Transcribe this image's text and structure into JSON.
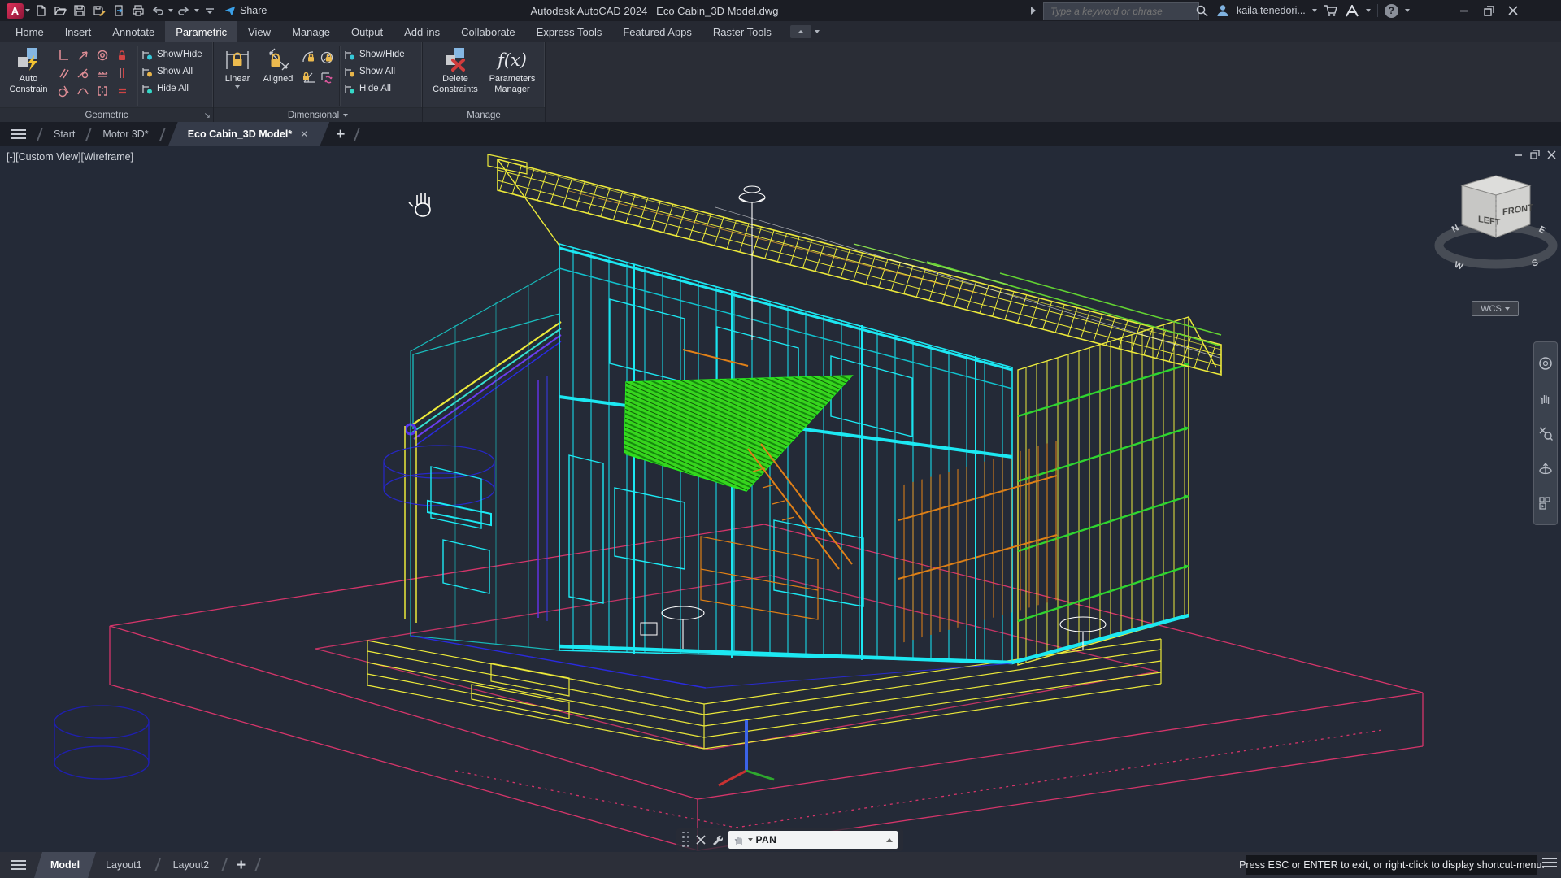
{
  "title_bar": {
    "logo_letter": "A",
    "share_label": "Share",
    "app_title": "Autodesk AutoCAD 2024",
    "file_name": "Eco Cabin_3D Model.dwg",
    "search_placeholder": "Type a keyword or phrase",
    "username": "kaila.tenedori...",
    "help_label": "?"
  },
  "ribbon": {
    "tabs": [
      "Home",
      "Insert",
      "Annotate",
      "Parametric",
      "View",
      "Manage",
      "Output",
      "Add-ins",
      "Collaborate",
      "Express Tools",
      "Featured Apps",
      "Raster Tools"
    ],
    "active_tab": "Parametric",
    "geometric": {
      "title": "Geometric",
      "auto_constrain_line1": "Auto",
      "auto_constrain_line2": "Constrain",
      "show_hide": "Show/Hide",
      "show_all": "Show All",
      "hide_all": "Hide All"
    },
    "dimensional": {
      "title": "Dimensional",
      "linear": "Linear",
      "aligned": "Aligned",
      "show_hide": "Show/Hide",
      "show_all": "Show All",
      "hide_all": "Hide All"
    },
    "manage": {
      "title": "Manage",
      "delete_line1": "Delete",
      "delete_line2": "Constraints",
      "params_line1": "Parameters",
      "params_line2": "Manager",
      "fx": "f(x)"
    }
  },
  "file_tabs": {
    "items": [
      "Start",
      "Motor 3D*",
      "Eco Cabin_3D Model*"
    ],
    "active": "Eco Cabin_3D Model*"
  },
  "viewport": {
    "controls": [
      "[-]",
      "[Custom View]",
      "[Wireframe]"
    ]
  },
  "viewcube": {
    "left_face": "LEFT",
    "front_face": "FRONT",
    "compass_n": "N",
    "compass_e": "E",
    "compass_s": "S",
    "compass_w": "W",
    "wcs": "WCS"
  },
  "command_line": {
    "command": "PAN"
  },
  "status_bar": {
    "tabs": [
      "Model",
      "Layout1",
      "Layout2"
    ],
    "active_tab": "Model",
    "hint": "Press ESC or ENTER to exit, or right-click to display shortcut-menu."
  },
  "colors": {
    "canvas_bg": "#242a37",
    "wire_cyan": "#1ce8f2",
    "wire_yellow": "#ece93a",
    "wire_green": "#35d42a",
    "wire_orange": "#e08018",
    "wire_pink": "#d5356a",
    "wire_blue": "#2a2ae0",
    "accent_gold": "#ecba4e",
    "accent_salmon": "#de8d95"
  }
}
